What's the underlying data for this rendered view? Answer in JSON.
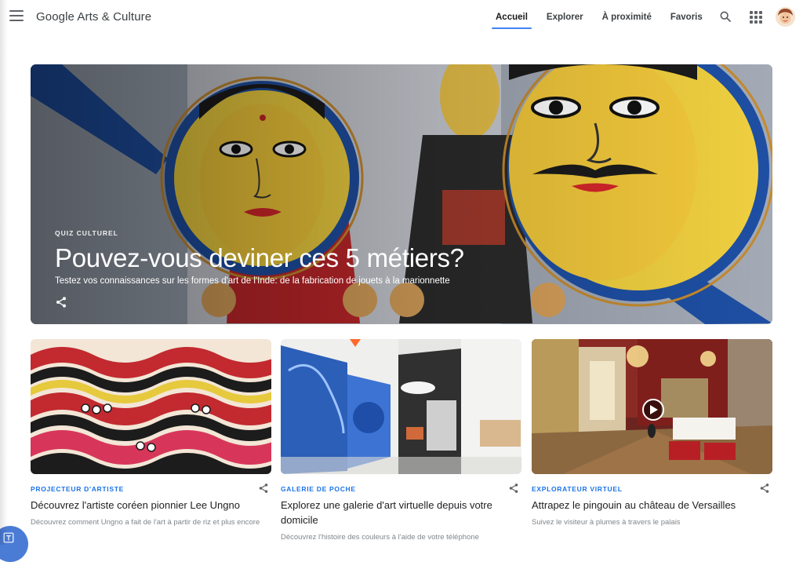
{
  "header": {
    "logo_text": "Google Arts & Culture",
    "nav": [
      {
        "label": "Accueil",
        "active": true
      },
      {
        "label": "Explorer",
        "active": false
      },
      {
        "label": "À proximité",
        "active": false
      },
      {
        "label": "Favoris",
        "active": false
      }
    ],
    "icons": [
      "menu-icon",
      "search-icon",
      "apps-icon",
      "avatar"
    ],
    "accent_color": "#4285f4"
  },
  "hero": {
    "eyebrow": "QUIZ CULTUREL",
    "title": "Pouvez-vous deviner ces 5 métiers?",
    "subtitle": "Testez vos connaissances sur les formes d'art de l'Inde: de la fabrication de jouets à la marionnette",
    "share_icon": "share-icon"
  },
  "cards": [
    {
      "eyebrow": "PROJECTEUR D'ARTISTE",
      "title": "Découvrez l'artiste coréen pionnier Lee Ungno",
      "desc": "Découvrez comment Ungno a fait de l'art à partir de riz et plus encore"
    },
    {
      "eyebrow": "GALERIE DE POCHE",
      "title": "Explorez une galerie d'art virtuelle depuis votre domicile",
      "desc": "Découvrez l'histoire des couleurs à l'aide de votre téléphone"
    },
    {
      "eyebrow": "EXPLORATEUR VIRTUEL",
      "title": "Attrapez le pingouin au château de Versailles",
      "desc": "Suivez le visiteur à plumes à travers le palais"
    }
  ],
  "colors": {
    "eyebrow_blue": "#1a73e8",
    "text_primary": "#202124",
    "text_secondary": "#80868b"
  }
}
